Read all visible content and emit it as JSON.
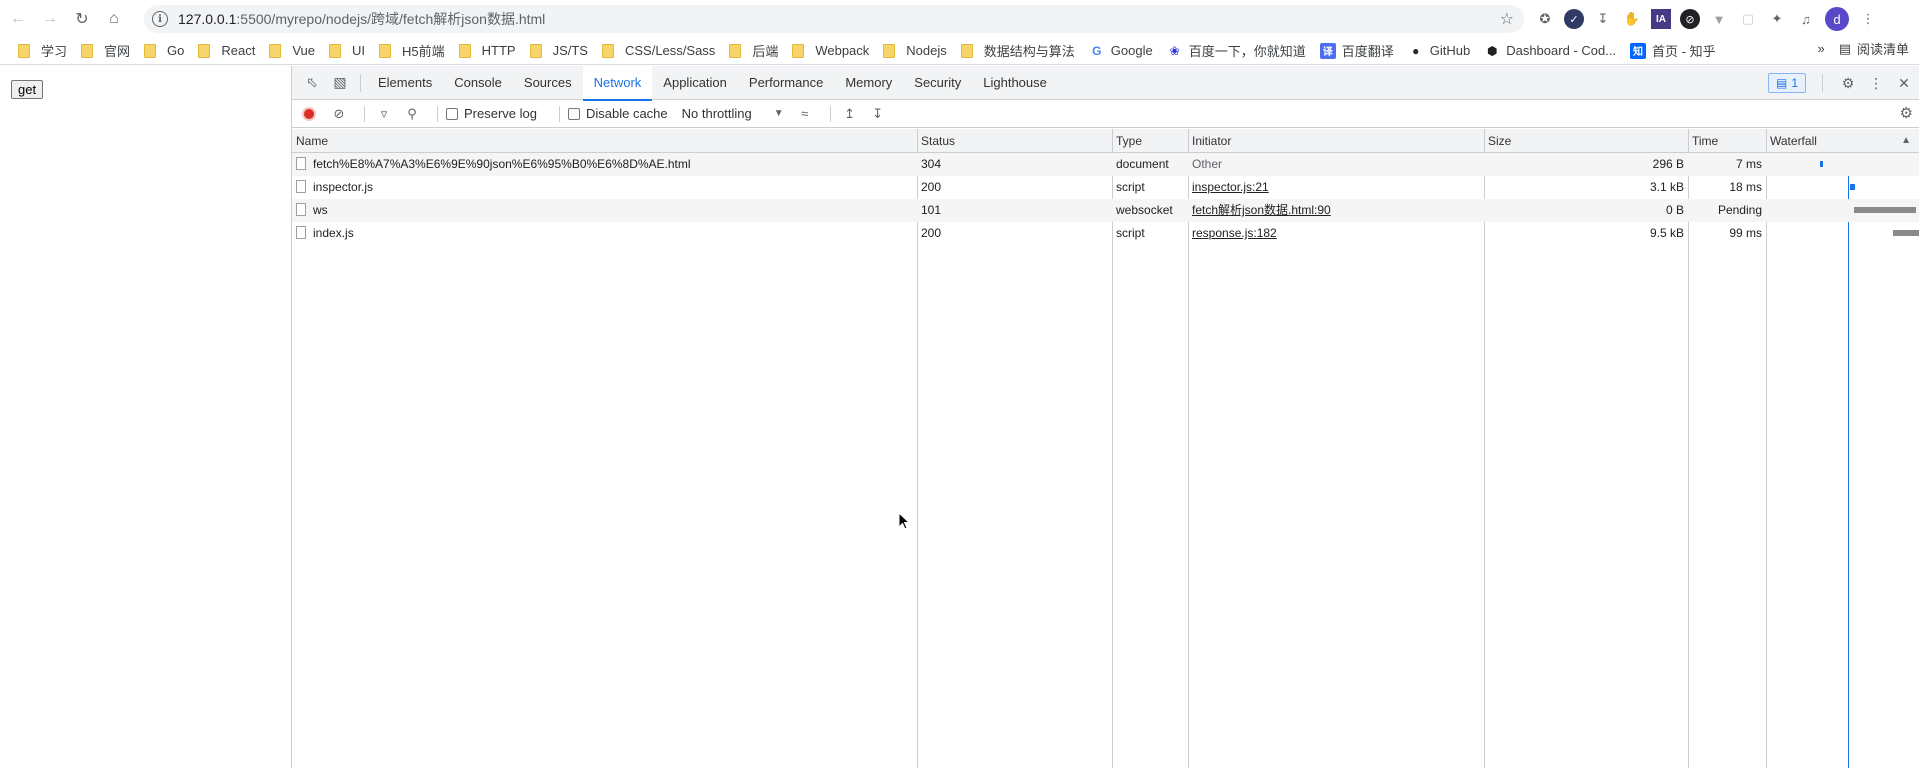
{
  "browser": {
    "url_host": "127.0.0.1",
    "url_path": ":5500/myrepo/nodejs/跨域/fetch解析json数据.html",
    "avatar_letter": "d",
    "reading_list": "阅读清单",
    "bookmarks_overflow": "»"
  },
  "bookmarks": [
    {
      "label": "学习",
      "icon": "folder"
    },
    {
      "label": "官网",
      "icon": "folder"
    },
    {
      "label": "Go",
      "icon": "folder"
    },
    {
      "label": "React",
      "icon": "folder"
    },
    {
      "label": "Vue",
      "icon": "folder"
    },
    {
      "label": "UI",
      "icon": "folder"
    },
    {
      "label": "H5前端",
      "icon": "folder"
    },
    {
      "label": "HTTP",
      "icon": "folder"
    },
    {
      "label": "JS/TS",
      "icon": "folder"
    },
    {
      "label": "CSS/Less/Sass",
      "icon": "folder"
    },
    {
      "label": "后端",
      "icon": "folder"
    },
    {
      "label": "Webpack",
      "icon": "folder"
    },
    {
      "label": "Nodejs",
      "icon": "folder"
    },
    {
      "label": "数据结构与算法",
      "icon": "folder"
    },
    {
      "label": "Google",
      "icon": "google-icon"
    },
    {
      "label": "百度一下，你就知道",
      "icon": "baidu-icon"
    },
    {
      "label": "百度翻译",
      "icon": "baidu-translate-icon"
    },
    {
      "label": "GitHub",
      "icon": "github-icon"
    },
    {
      "label": "Dashboard - Cod...",
      "icon": "codepen-icon"
    },
    {
      "label": "首页 - 知乎",
      "icon": "zhihu-icon"
    }
  ],
  "page": {
    "button_label": "get"
  },
  "devtools": {
    "tabs": [
      "Elements",
      "Console",
      "Sources",
      "Network",
      "Application",
      "Performance",
      "Memory",
      "Security",
      "Lighthouse"
    ],
    "active_tab": "Network",
    "issues_count": "1",
    "toolbar": {
      "preserve_log": "Preserve log",
      "disable_cache": "Disable cache",
      "throttling": "No throttling"
    },
    "columns": [
      "Name",
      "Status",
      "Type",
      "Initiator",
      "Size",
      "Time",
      "Waterfall"
    ],
    "requests": [
      {
        "name": "fetch%E8%A7%A3%E6%9E%90json%E6%95%B0%E6%8D%AE.html",
        "status": "304",
        "type": "document",
        "initiator": "Other",
        "initiator_link": false,
        "size": "296 B",
        "time": "7 ms"
      },
      {
        "name": "inspector.js",
        "status": "200",
        "type": "script",
        "initiator": "inspector.js:21",
        "initiator_link": true,
        "size": "3.1 kB",
        "time": "18 ms"
      },
      {
        "name": "ws",
        "status": "101",
        "type": "websocket",
        "initiator": "fetch解析json数据.html:90",
        "initiator_link": true,
        "size": "0 B",
        "time": "Pending"
      },
      {
        "name": "index.js",
        "status": "200",
        "type": "script",
        "initiator": "response.js:182",
        "initiator_link": true,
        "size": "9.5 kB",
        "time": "99 ms"
      }
    ]
  },
  "colors": {
    "accent": "#1a73e8",
    "record": "#d93025",
    "waterfall_blue": "#1a73e8",
    "waterfall_gray": "#8a8a8a"
  }
}
